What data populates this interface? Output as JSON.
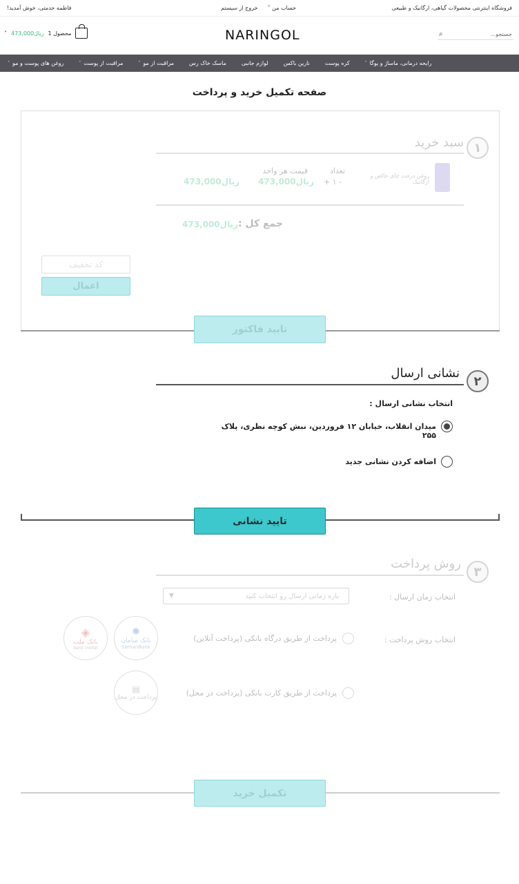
{
  "topbar": {
    "store_tagline": "فروشگاه اینترنتی محصولات گیاهی، ارگانیک و طبیعی",
    "account_label": "حساب من",
    "logout_label": "خروج از سیستم",
    "welcome_text": "فاطمه حدمتی، خوش آمدید!"
  },
  "header": {
    "logo": "NARINGOL",
    "search_placeholder": "جستجو...",
    "cart_count": "1 محصول",
    "cart_total": "473,000ریال"
  },
  "nav": {
    "items": [
      {
        "label": "روغن های پوست و مو",
        "dropdown": true
      },
      {
        "label": "مراقبت از پوست",
        "dropdown": true
      },
      {
        "label": "مراقبت از مو",
        "dropdown": true
      },
      {
        "label": "ماسک خاک رس",
        "dropdown": false
      },
      {
        "label": "لوازم جانبی",
        "dropdown": false
      },
      {
        "label": "نارین باکس",
        "dropdown": false
      },
      {
        "label": "کره پوست",
        "dropdown": false
      },
      {
        "label": "رایحه درمانی، ماساژ و یوگا",
        "dropdown": true
      }
    ]
  },
  "page_title": "صفحه تکمیل خرید و پرداخت",
  "step1": {
    "number": "۱",
    "title": "سبد خرید",
    "product_name": "روغن درخت چای خالص و ارگانیک",
    "qty_label": "تعداد",
    "qty_control": "+ ۱ -",
    "unit_price_label": "قیمت هر واحد",
    "unit_price": "473,000ریال",
    "line_total": "473,000ریال",
    "sum_label": "جمع کل :",
    "sum_value": "473,000ریال",
    "coupon_placeholder": "کد تخفیف",
    "apply_label": "اعمال",
    "confirm_label": "تایید فاکتور"
  },
  "step2": {
    "number": "۲",
    "title": "نشانی ارسال",
    "select_label": "انتخاب نشانی ارسال :",
    "address": "میدان انقلاب، خیابان ۱۲ فروردین، نبش کوچه نظری، پلاک ۲۵۵",
    "add_new": "اضافه کردن نشانی جدید",
    "confirm_label": "تایید نشانی"
  },
  "step3": {
    "number": "۳",
    "title": "روش پرداخت",
    "time_label": "انتخاب زمان ارسال :",
    "time_placeholder": "بازه زمانی ارسال رو انتخاب کنید",
    "method_label": "انتخاب روش پرداخت :",
    "online_option": "پرداخت از طریق درگاه بانکی (پرداخت آنلاین)",
    "card_option": "پرداخت از طریق کارت بانکی (پرداخت در محل)",
    "saman_logo": "بانک سامان",
    "saman_en": "SamanBank",
    "mellat_logo": "بانک ملت",
    "mellat_en": "bank mellat",
    "pos_logo": "پرداخت در محل",
    "finish_label": "تکمیل خرید"
  },
  "colors": {
    "accent": "#3cc8cc",
    "nav_bg": "#55535a",
    "price": "#2ebd7a"
  }
}
